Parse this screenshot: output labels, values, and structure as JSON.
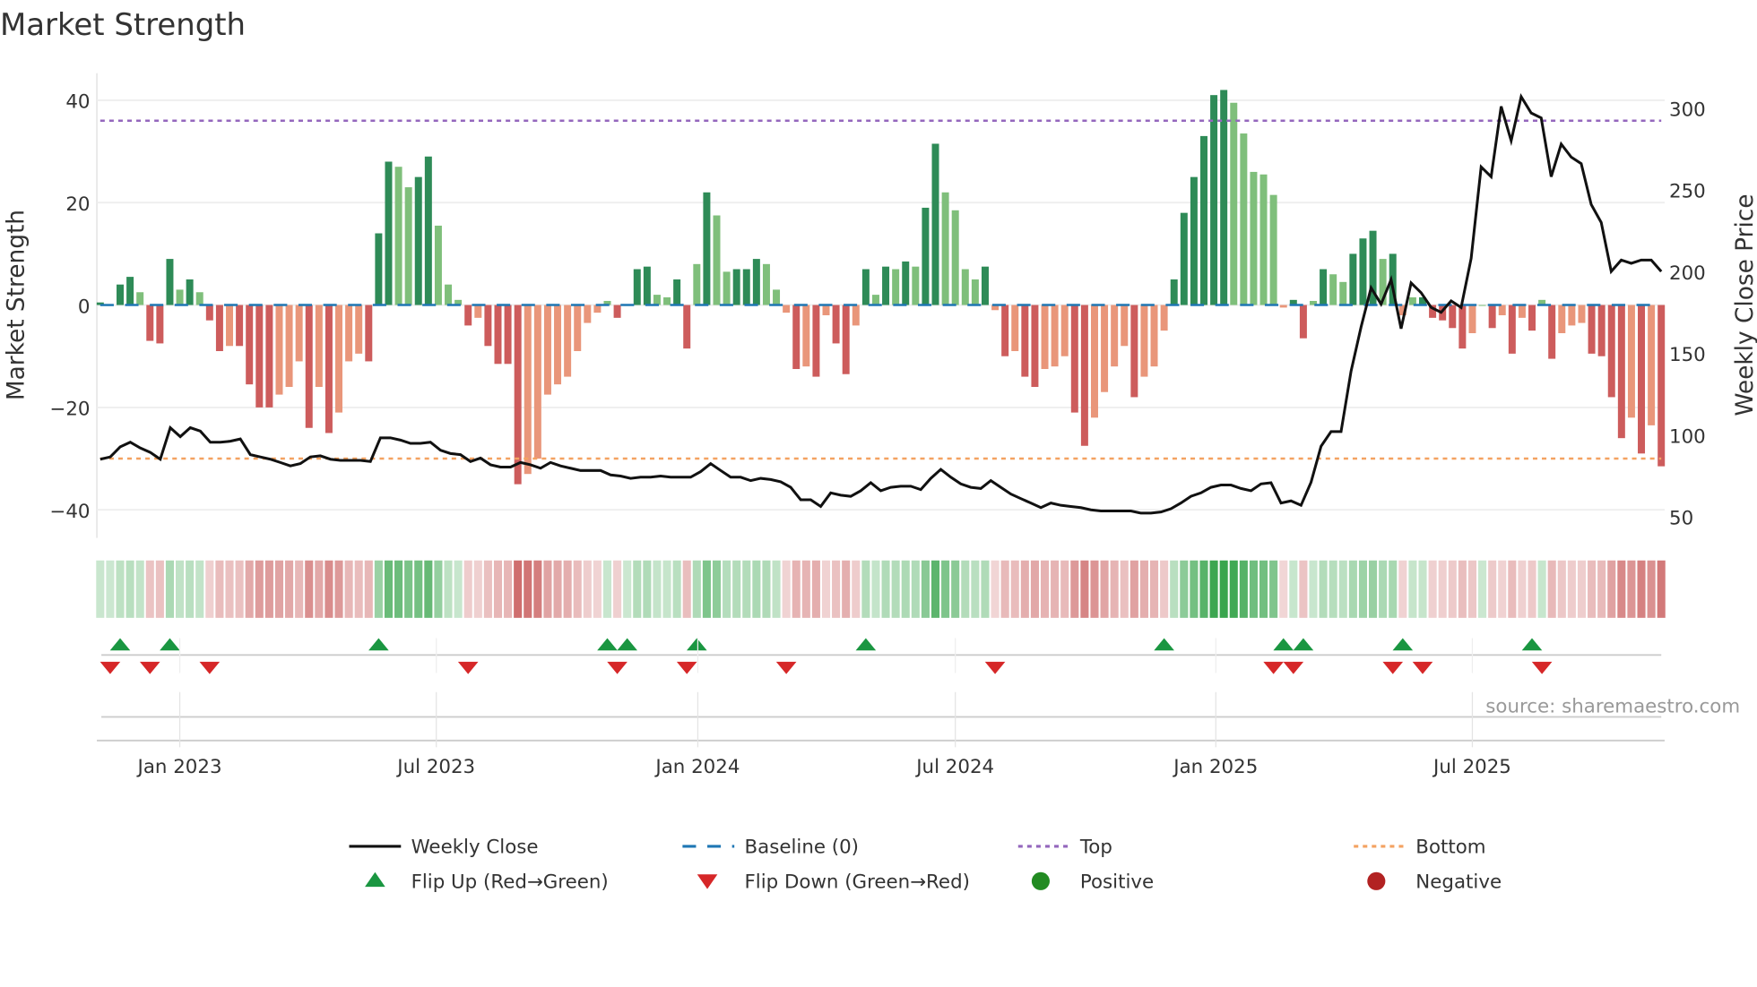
{
  "chart_data": {
    "type": "bar",
    "title": "Market Strength",
    "ylabel": "Market Strength",
    "y2label": "Weekly Close Price",
    "ylim": [
      -45,
      45
    ],
    "y2lim": [
      45,
      310
    ],
    "yticks": [
      "40",
      "20",
      "0",
      "−20",
      "−40"
    ],
    "ytick_values": [
      40,
      20,
      0,
      -20,
      -40
    ],
    "y2ticks": [
      "300",
      "250",
      "200",
      "150",
      "100",
      "50"
    ],
    "y2tick_values": [
      300,
      250,
      200,
      150,
      100,
      50
    ],
    "xticks": [
      "Jan 2023",
      "Jul 2023",
      "Jan 2024",
      "Jul 2024",
      "Jan 2025",
      "Jul 2025"
    ],
    "xtick_week_index": [
      8.0,
      33.8,
      60.1,
      86.0,
      112.2,
      138.0
    ],
    "top_level": 36,
    "bottom_level": -30,
    "baseline": 0,
    "source": "source: sharemaestro.com",
    "strength": [
      0.5,
      0,
      4,
      5.5,
      2.5,
      -7,
      -7.5,
      9,
      3,
      5,
      2.5,
      -3,
      -9,
      -8,
      -8,
      -15.5,
      -20,
      -20,
      -17.5,
      -16,
      -11,
      -24,
      -16,
      -25,
      -21,
      -11,
      -9.5,
      -11,
      14,
      28,
      27,
      23,
      25,
      29,
      15.5,
      4,
      1,
      -4,
      -2.5,
      -8,
      -11.5,
      -11.5,
      -35,
      -33,
      -30,
      -17.5,
      -15.5,
      -14,
      -9,
      -3.5,
      -1.5,
      0.8,
      -2.5,
      0,
      7,
      7.5,
      2,
      1.5,
      5,
      -8.5,
      8,
      22,
      17.5,
      6.5,
      7,
      7,
      9,
      8,
      3,
      -1.5,
      -12.5,
      -12,
      -14,
      -2,
      -7.5,
      -13.5,
      -4,
      7,
      2,
      7.5,
      7,
      8.5,
      7.5,
      19,
      31.5,
      22,
      18.5,
      7,
      5,
      7.5,
      -1,
      -10,
      -9,
      -14,
      -16,
      -12.5,
      -12,
      -10,
      -21,
      -27.5,
      -22,
      -17,
      -12,
      -8,
      -18,
      -14,
      -12,
      -5,
      5,
      18,
      25,
      33,
      41,
      42,
      39.5,
      33.5,
      26,
      25.5,
      21.5,
      -0.5,
      1,
      -6.5,
      0.8,
      7,
      6,
      4.5,
      10,
      13,
      14.5,
      9,
      10,
      -2,
      1.5,
      1.5,
      -2.5,
      -3,
      -4.5,
      -8.5,
      -5.5,
      0,
      -4.5,
      -2,
      -9.5,
      -2.5,
      -5,
      1,
      -10.5,
      -5.5,
      -4,
      -3.5,
      -9.5,
      -10,
      -18,
      -26,
      -22,
      -29,
      -23.5,
      -31.5
    ],
    "weekly_close": [
      85.1,
      86.5,
      92.7,
      95.5,
      92,
      89.3,
      85.1,
      104.4,
      98.9,
      104.4,
      102.3,
      95.5,
      95.5,
      96.1,
      97.5,
      87.9,
      86.5,
      85.1,
      83.1,
      81,
      82.4,
      86.5,
      87.2,
      85.1,
      84.4,
      84.4,
      84.4,
      83.7,
      98.2,
      98.2,
      96.8,
      94.8,
      94.8,
      95.5,
      90.6,
      88.6,
      87.9,
      83.7,
      85.8,
      81.7,
      80.3,
      80.3,
      83.1,
      81.7,
      79.6,
      83.1,
      81,
      79.6,
      78.2,
      78.2,
      78.2,
      75.5,
      74.8,
      73.4,
      74.1,
      74.1,
      74.8,
      74.1,
      74.1,
      74.1,
      77.5,
      82.4,
      78.2,
      74.1,
      74.1,
      72,
      73.4,
      72.7,
      71.3,
      67.9,
      60.3,
      60.3,
      56.2,
      64.5,
      63.1,
      62.4,
      65.8,
      70.7,
      65.8,
      67.9,
      68.6,
      68.6,
      66.5,
      73.4,
      78.9,
      74.1,
      70,
      67.9,
      67.2,
      72,
      67.9,
      63.8,
      61,
      58.3,
      55.5,
      58.3,
      56.9,
      56.2,
      55.5,
      54.1,
      53.4,
      53.4,
      53.4,
      53.4,
      52.1,
      52.1,
      52.8,
      54.8,
      58.3,
      62.4,
      64.5,
      67.9,
      69.3,
      69.3,
      67.2,
      65.8,
      70,
      70.7,
      58.3,
      59.6,
      56.9,
      71,
      93,
      102,
      102,
      139,
      166,
      190,
      180,
      195,
      165,
      193,
      187,
      178,
      175,
      182,
      178,
      208,
      264,
      258,
      301,
      280,
      307,
      297,
      294,
      258,
      278,
      270,
      266,
      241,
      230,
      200,
      207,
      205,
      207,
      207,
      200
    ],
    "flip_up_week_index": [
      2,
      7,
      28,
      51,
      53,
      60,
      77,
      107,
      119,
      121,
      131,
      144
    ],
    "flip_down_week_index": [
      1,
      5,
      11,
      37,
      52,
      59,
      69,
      90,
      118,
      120,
      130,
      133,
      145
    ],
    "legend": {
      "placement": "bottom",
      "items": [
        {
          "label": "Weekly Close",
          "kind": "line-solid",
          "color": "#111111"
        },
        {
          "label": "Baseline (0)",
          "kind": "line-dashed",
          "color": "#1f77b4"
        },
        {
          "label": "Top",
          "kind": "line-dotted",
          "color": "#9467bd"
        },
        {
          "label": "Bottom",
          "kind": "line-dotted",
          "color": "#f4a261"
        },
        {
          "label": "Flip Up (Red→Green)",
          "kind": "triangle-up",
          "color": "#1a9641"
        },
        {
          "label": "Flip Down (Green→Red)",
          "kind": "triangle-down",
          "color": "#d62728"
        },
        {
          "label": "Positive",
          "kind": "dot",
          "color": "#228b22"
        },
        {
          "label": "Negative",
          "kind": "dot",
          "color": "#b22222"
        }
      ]
    },
    "colors": {
      "pos_strong": "#2e8b57",
      "pos_weak": "#7fbf7b",
      "neg_strong": "#cd5c5c",
      "neg_weak": "#e9967a",
      "top": "#9467bd",
      "bottom": "#f4a261",
      "baseline": "#1f77b4",
      "price": "#111111"
    }
  }
}
